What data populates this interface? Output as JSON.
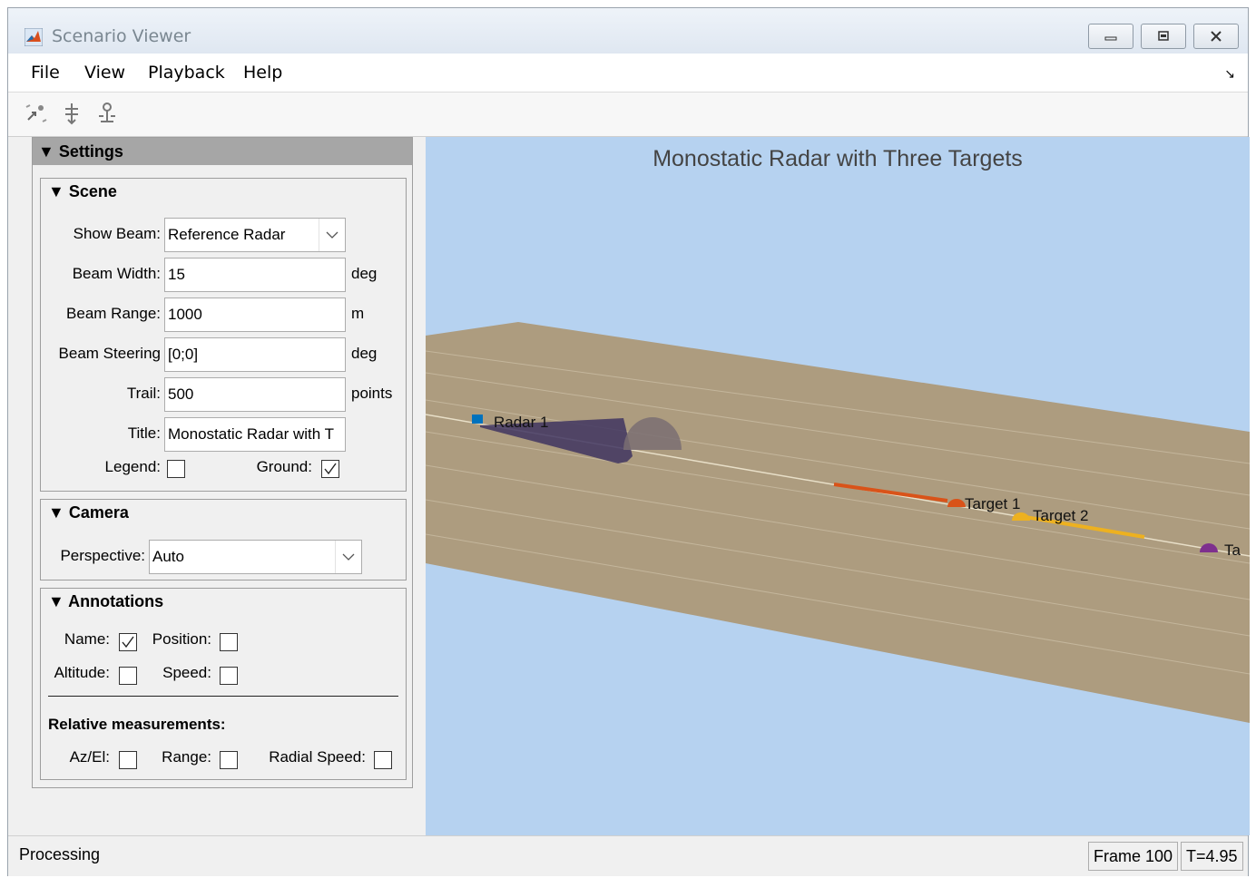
{
  "window": {
    "title": "Scenario Viewer",
    "controls": [
      "minimize",
      "maximize",
      "close"
    ]
  },
  "menu": {
    "file": "File",
    "view": "View",
    "playback": "Playback",
    "help": "Help"
  },
  "toolbar": {
    "icons": [
      "move-camera-icon",
      "rotate-camera-icon",
      "reset-camera-icon"
    ]
  },
  "settings": {
    "header": "Settings",
    "scene": {
      "title": "Scene",
      "show_beam_label": "Show Beam:",
      "show_beam_value": "Reference Radar",
      "beam_width_label": "Beam Width:",
      "beam_width_value": "15",
      "beam_width_unit": "deg",
      "beam_range_label": "Beam Range:",
      "beam_range_value": "1000",
      "beam_range_unit": "m",
      "beam_steering_label": "Beam Steering",
      "beam_steering_value": "[0;0]",
      "beam_steering_unit": "deg",
      "trail_label": "Trail:",
      "trail_value": "500",
      "trail_unit": "points",
      "title_label": "Title:",
      "title_value": "Monostatic Radar with T",
      "legend_label": "Legend:",
      "legend_checked": false,
      "ground_label": "Ground:",
      "ground_checked": true
    },
    "camera": {
      "title": "Camera",
      "perspective_label": "Perspective:",
      "perspective_value": "Auto"
    },
    "annotations": {
      "title": "Annotations",
      "name_label": "Name:",
      "name_checked": true,
      "position_label": "Position:",
      "position_checked": false,
      "altitude_label": "Altitude:",
      "altitude_checked": false,
      "speed_label": "Speed:",
      "speed_checked": false,
      "relative_title": "Relative measurements:",
      "azel_label": "Az/El:",
      "azel_checked": false,
      "range_label": "Range:",
      "range_checked": false,
      "radial_speed_label": "Radial Speed:",
      "radial_speed_checked": false
    }
  },
  "scene_view": {
    "title": "Monostatic Radar with Three Targets",
    "sky_color": "#b6d2f0",
    "ground_color": "#ad9c7f",
    "labels": {
      "radar": "Radar 1",
      "target1": "Target 1",
      "target2": "Target 2",
      "target3": "Ta"
    },
    "colors": {
      "radar": "#0072bd",
      "target1": "#d95319",
      "target2": "#edb120",
      "target3": "#7e2f8e",
      "beam": "#3f3560"
    }
  },
  "status": {
    "text": "Processing",
    "frame": "Frame 100",
    "time": "T=4.95"
  }
}
